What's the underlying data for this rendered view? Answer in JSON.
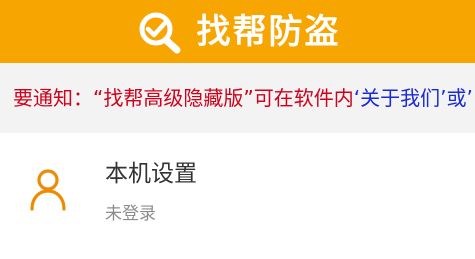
{
  "header": {
    "title": "找帮防盗",
    "logo_icon": "magnifier-check-icon",
    "background": "#F7A500"
  },
  "notice": {
    "prefix": "要通知：",
    "quote_part": "“找帮高级隐藏版”可在软件内",
    "blue_part": "‘关于我们’或’",
    "colors": {
      "red": "#D0021B",
      "blue": "#1A2BD6"
    }
  },
  "profile": {
    "avatar_icon": "user-icon",
    "title": "本机设置",
    "subtitle": "未登录",
    "accent": "#F08A00"
  }
}
